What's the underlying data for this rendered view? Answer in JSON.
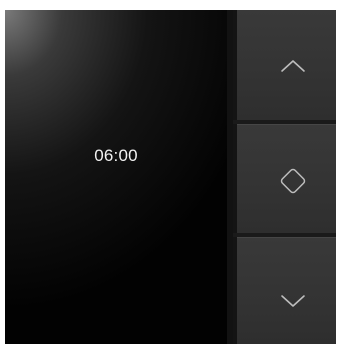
{
  "screen": {
    "time": "06:00"
  },
  "buttons": {
    "up": {
      "icon": "chevron-up-icon"
    },
    "home": {
      "icon": "diamond-icon"
    },
    "down": {
      "icon": "chevron-down-icon"
    }
  },
  "colors": {
    "device_body": "#1e1e1e",
    "button_face": "#363636",
    "icon_stroke": "#bdbdbd",
    "text": "#f2f2f2"
  }
}
